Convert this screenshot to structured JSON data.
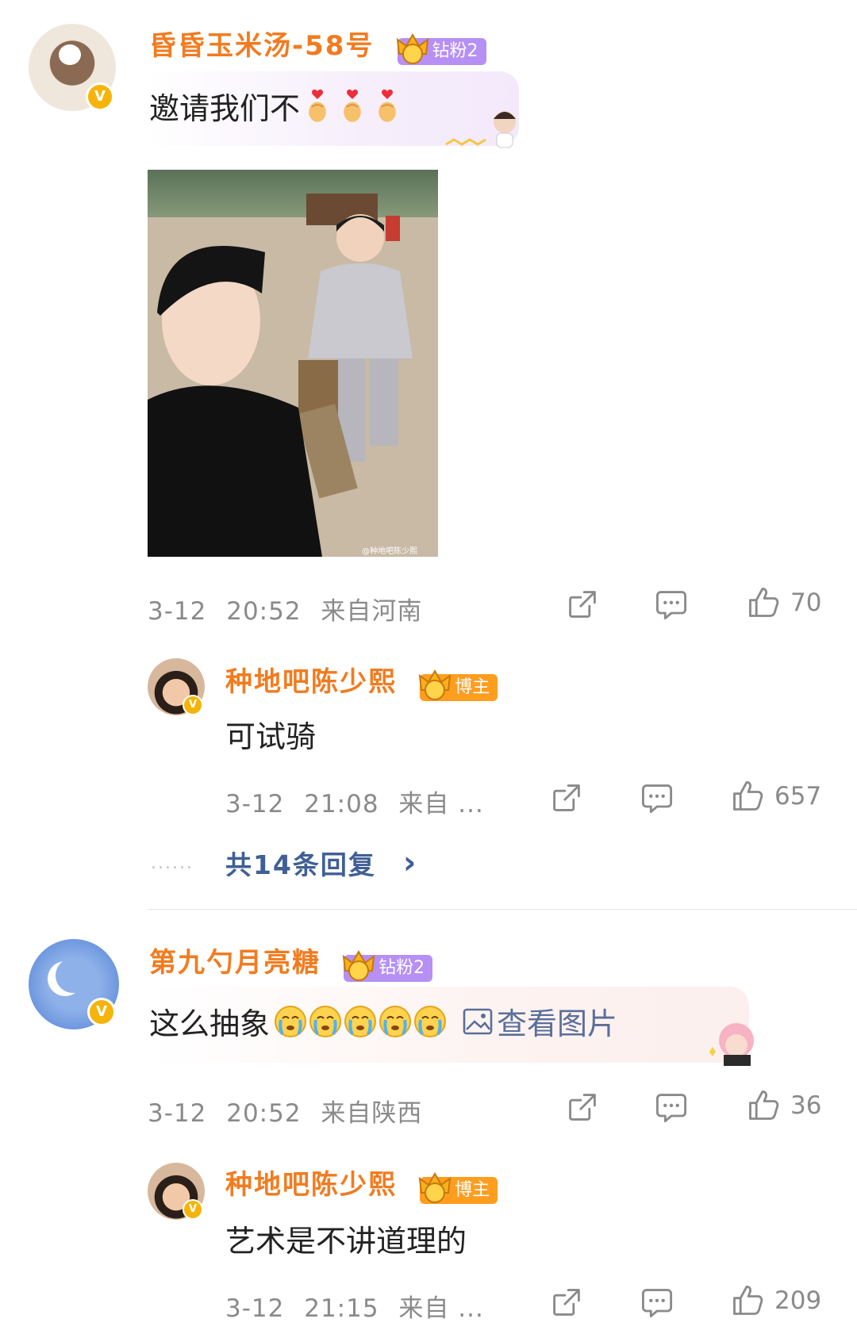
{
  "comments": [
    {
      "user": {
        "name": "昏昏玉米汤-58号",
        "badge": "钻粉2",
        "badge_level": "5"
      },
      "text": "邀请我们不",
      "emoji": [
        "finger-heart",
        "finger-heart",
        "finger-heart"
      ],
      "meta": {
        "date": "3-12",
        "time": "20:52",
        "location": "来自河南"
      },
      "likes": "70",
      "photo_watermark": "@种地吧陈少熙",
      "reply": {
        "user": {
          "name": "种地吧陈少熙",
          "badge": "博主",
          "badge_level": "7"
        },
        "text": "可试骑",
        "meta": {
          "date": "3-12",
          "time": "21:08",
          "location": "来自 ..."
        },
        "likes": "657"
      },
      "more_replies": {
        "dots": "......",
        "label": "共14条回复",
        "chevron": "›"
      }
    },
    {
      "user": {
        "name": "第九勺月亮糖",
        "badge": "钻粉2",
        "badge_level": "5"
      },
      "text": "这么抽象",
      "emoji": [
        "crying-face",
        "crying-face",
        "crying-face",
        "crying-face",
        "crying-face"
      ],
      "image_link": "查看图片",
      "meta": {
        "date": "3-12",
        "time": "20:52",
        "location": "来自陕西"
      },
      "likes": "36",
      "reply": {
        "user": {
          "name": "种地吧陈少熙",
          "badge": "博主",
          "badge_level": "7"
        },
        "text": "艺术是不讲道理的",
        "meta": {
          "date": "3-12",
          "time": "21:15",
          "location": "来自 ..."
        },
        "likes": "209"
      }
    }
  ],
  "colors": {
    "name": "#f27b1f",
    "fan_badge": "#b690f4",
    "host_badge": "#ff9d1f",
    "link": "#3f5f96",
    "meta": "#8a8a8a",
    "verified": "#f6b40b"
  },
  "icons": {
    "share": "share-icon",
    "comment": "comment-icon",
    "like": "thumbs-up-icon",
    "verified": "verified-v-icon",
    "image": "image-icon"
  }
}
